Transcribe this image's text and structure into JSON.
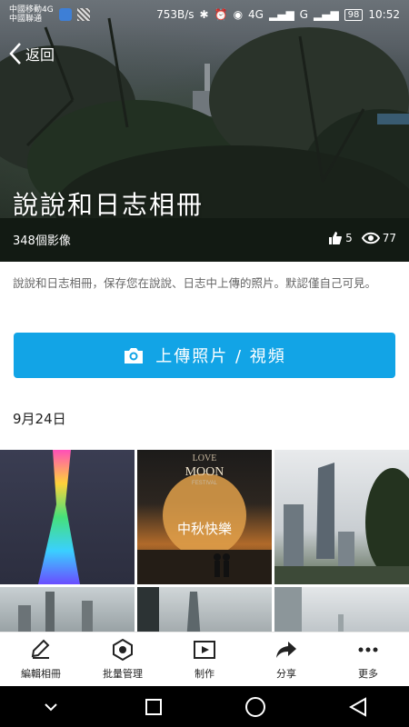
{
  "status": {
    "carrier1": "中國移動4G",
    "carrier2": "中國聯通",
    "speed": "753B/s",
    "network": "4G",
    "network2": "G",
    "battery": "98",
    "time": "10:52"
  },
  "header": {
    "back_label": "返回",
    "album_title": "說說和日志相冊",
    "photo_count": "348個影像",
    "likes": "5",
    "views": "77"
  },
  "description": "說說和日志相冊，保存您在說說、日志中上傳的照片。默認僅自己可見。",
  "upload_button": {
    "label": "上傳照片 / 視頻"
  },
  "date_header": "9月24日",
  "photos": {
    "t2_line1": "LOVE",
    "t2_line2": "MOON",
    "t2_line3": "FESTIVAL",
    "t2_line4": "中秋快樂"
  },
  "toolbar": {
    "items": [
      {
        "label": "編輯相冊",
        "icon": "edit-icon"
      },
      {
        "label": "批量管理",
        "icon": "batch-icon"
      },
      {
        "label": "制作",
        "icon": "video-icon"
      },
      {
        "label": "分享",
        "icon": "share-icon"
      },
      {
        "label": "更多",
        "icon": "more-icon"
      }
    ]
  },
  "colors": {
    "accent": "#12a4e6"
  }
}
